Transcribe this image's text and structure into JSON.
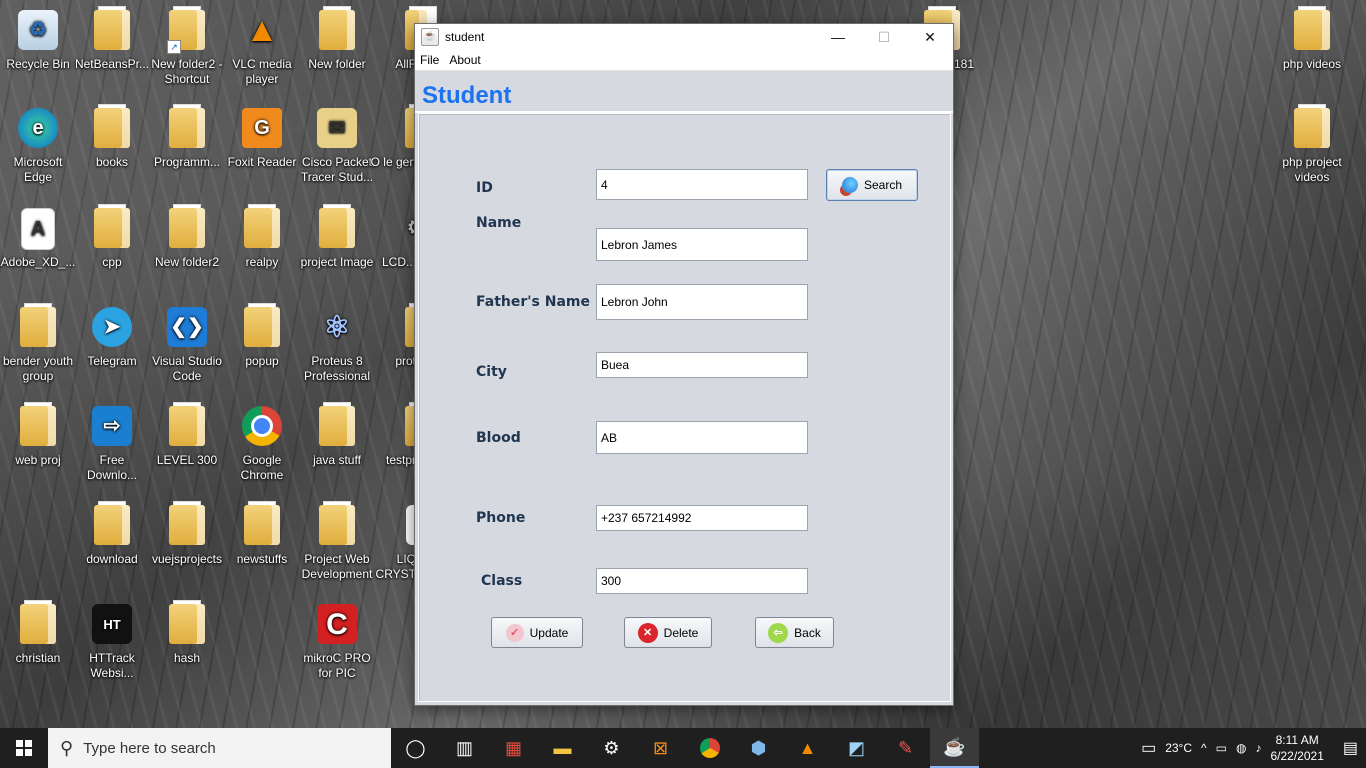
{
  "desktop": {
    "icons": [
      {
        "label": "Recycle Bin",
        "kind": "recycle-bin-icon"
      },
      {
        "label": "NetBeansPr...",
        "kind": "folder-icon"
      },
      {
        "label": "New folder2 - Shortcut",
        "kind": "folder-icon"
      },
      {
        "label": "VLC media player",
        "kind": "vlc-icon"
      },
      {
        "label": "New folder",
        "kind": "folder-icon"
      },
      {
        "label": "AllF",
        "kind": "folder-icon"
      },
      {
        "label": "181",
        "kind": "folder-icon"
      },
      {
        "label": "php videos",
        "kind": "folder-icon"
      },
      {
        "label": "Microsoft Edge",
        "kind": "edge-icon"
      },
      {
        "label": "books",
        "kind": "folder-icon"
      },
      {
        "label": "Programm...",
        "kind": "folder-icon"
      },
      {
        "label": "Foxit Reader",
        "kind": "foxit-icon"
      },
      {
        "label": "Cisco Packet Tracer Stud...",
        "kind": "packet-tracer-icon"
      },
      {
        "label": "O le gen",
        "kind": "file-icon"
      },
      {
        "label": "php project videos",
        "kind": "folder-icon"
      },
      {
        "label": "Adobe_XD_...",
        "kind": "file-icon"
      },
      {
        "label": "cpp",
        "kind": "folder-icon"
      },
      {
        "label": "New folder2",
        "kind": "folder-icon"
      },
      {
        "label": "realpy",
        "kind": "folder-icon"
      },
      {
        "label": "project Image",
        "kind": "folder-icon"
      },
      {
        "label": "LCD...",
        "kind": "gear-icon"
      },
      {
        "label": "bender youth group",
        "kind": "folder-icon"
      },
      {
        "label": "Telegram",
        "kind": "telegram-icon"
      },
      {
        "label": "Visual Studio Code",
        "kind": "vscode-icon"
      },
      {
        "label": "popup",
        "kind": "folder-icon"
      },
      {
        "label": "Proteus 8 Professional",
        "kind": "proteus-icon"
      },
      {
        "label": "prot",
        "kind": "folder-icon"
      },
      {
        "label": "web proj",
        "kind": "folder-icon"
      },
      {
        "label": "Free Downlo...",
        "kind": "download-icon"
      },
      {
        "label": "LEVEL 300",
        "kind": "folder-icon"
      },
      {
        "label": "Google Chrome",
        "kind": "chrome-icon"
      },
      {
        "label": "java stuff",
        "kind": "folder-icon"
      },
      {
        "label": "testpr",
        "kind": "folder-icon"
      },
      {
        "label": "download",
        "kind": "folder-icon"
      },
      {
        "label": "vuejsprojects",
        "kind": "folder-icon"
      },
      {
        "label": "newstuffs",
        "kind": "folder-icon"
      },
      {
        "label": "Project Web Development",
        "kind": "folder-icon"
      },
      {
        "label": "LIQ CRYST",
        "kind": "file-icon"
      },
      {
        "label": "christian",
        "kind": "folder-icon"
      },
      {
        "label": "HTTrack Websi...",
        "kind": "httrack-icon"
      },
      {
        "label": "hash",
        "kind": "folder-icon"
      },
      {
        "label": "mikroC PRO for PIC",
        "kind": "mikroc-icon"
      }
    ]
  },
  "window": {
    "title": "student",
    "menu": [
      "File",
      "About"
    ],
    "heading": "Student",
    "form": {
      "id_label": "ID",
      "id_value": "4",
      "search_label": "Search",
      "name_label": "Name",
      "name_value": "Lebron James",
      "father_label": "Father's Name",
      "father_value": "Lebron John",
      "city_label": "City",
      "city_value": "Buea",
      "blood_label": "Blood",
      "blood_value": "AB",
      "phone_label": "Phone",
      "phone_value": "+237 657214992",
      "class_label": "Class",
      "class_value": "300"
    },
    "buttons": {
      "update": "Update",
      "delete": "Delete",
      "back": "Back"
    }
  },
  "taskbar": {
    "search_placeholder": "Type here to search",
    "temperature": "23°C",
    "time": "8:11 AM",
    "date": "6/22/2021"
  }
}
